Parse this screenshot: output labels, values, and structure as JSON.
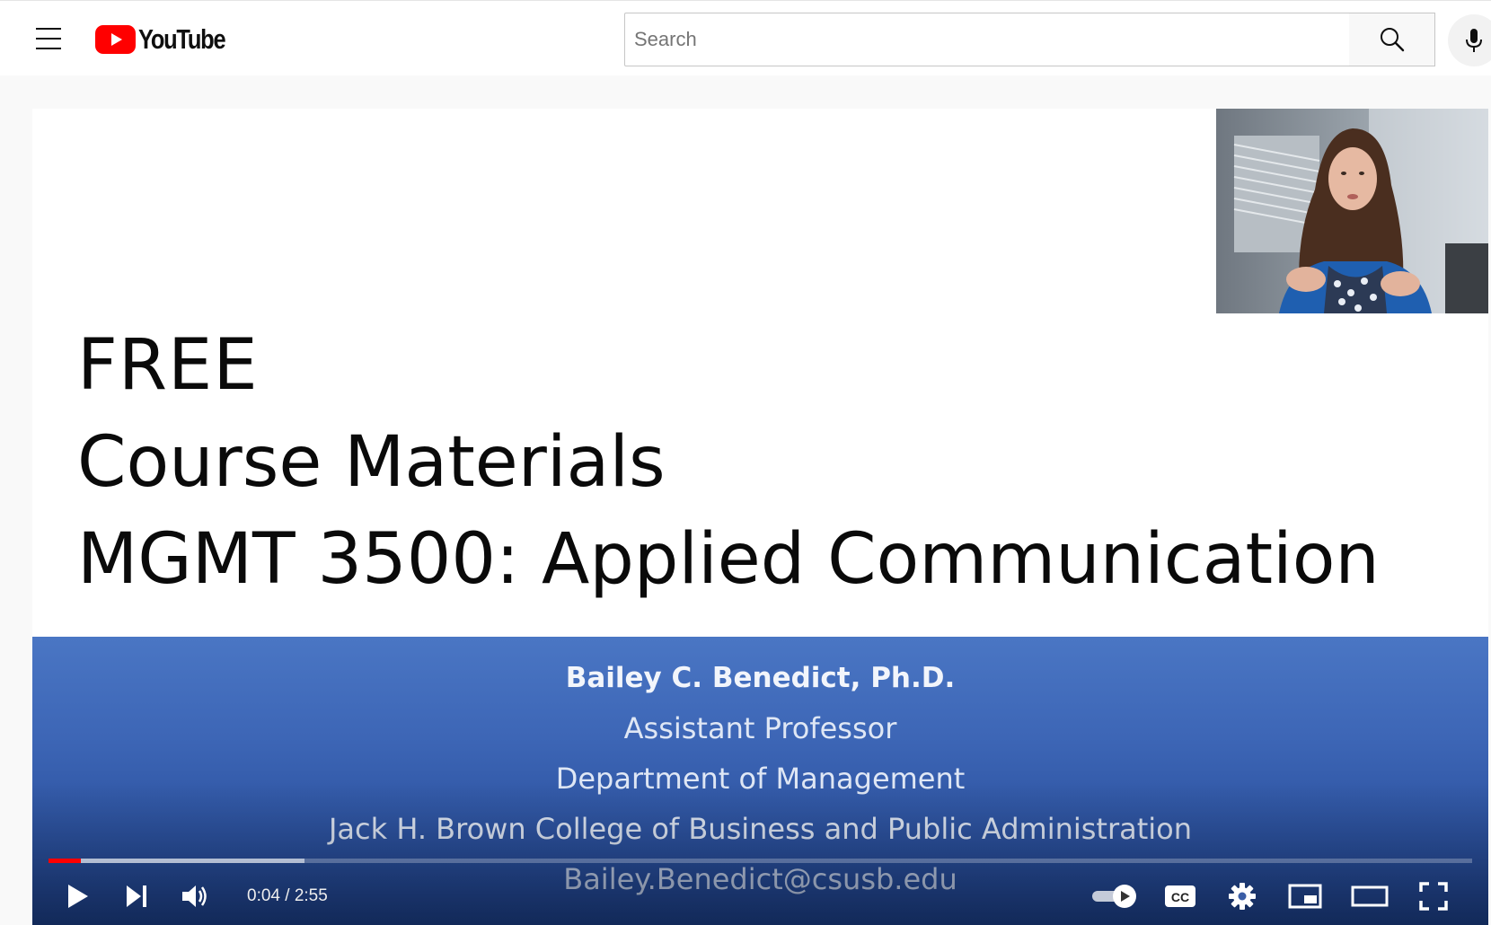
{
  "header": {
    "menu_icon": "hamburger-menu-icon",
    "logo_text": "YouTube",
    "search_placeholder": "Search",
    "search_value": "",
    "search_icon": "search-icon",
    "mic_icon": "microphone-icon"
  },
  "slide": {
    "line1": "FREE",
    "line2": "Course Materials",
    "line3": "MGMT 3500: Applied Communication",
    "presenter_name": "Bailey C. Benedict, Ph.D.",
    "title": "Assistant Professor",
    "department": "Department of Management",
    "college": "Jack H. Brown College of Business and Public Administration",
    "email": "Bailey.Benedict@csusb.edu"
  },
  "player": {
    "current_time": "0:04",
    "duration": "2:55",
    "time_display": "0:04 / 2:55",
    "played_fraction": 0.023,
    "buffered_fraction": 0.18,
    "autoplay_on": true,
    "controls": [
      "play-icon",
      "next-icon",
      "volume-icon",
      "autoplay-toggle",
      "cc-icon",
      "settings-gear-icon",
      "miniplayer-icon",
      "theater-mode-icon",
      "fullscreen-icon"
    ]
  },
  "colors": {
    "brand_red": "#ff0000",
    "slide_blue_top": "#4a76c4",
    "slide_blue_bottom": "#1c3f88"
  }
}
